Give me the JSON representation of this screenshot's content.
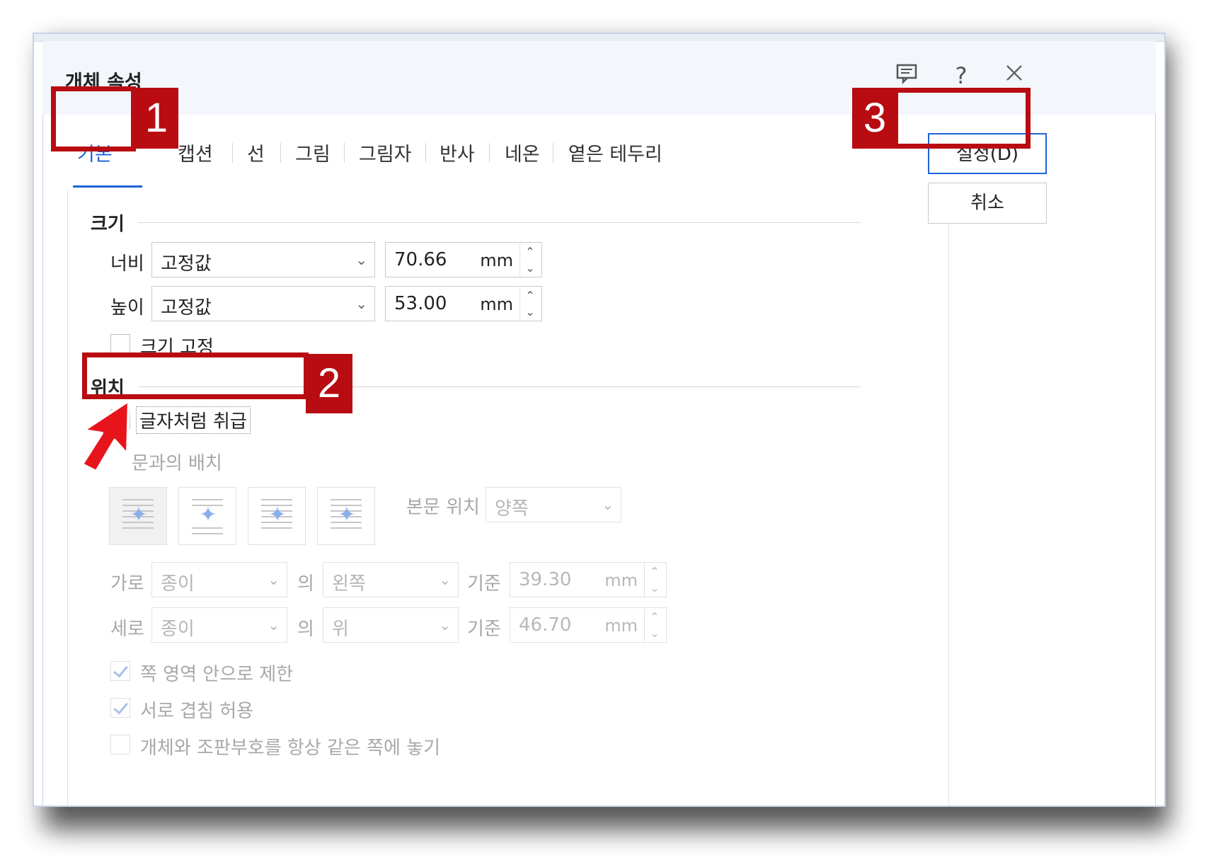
{
  "dialog": {
    "title": "개체 속성"
  },
  "titlebar_icons": [
    "comment-icon",
    "help-icon",
    "close-icon"
  ],
  "tabs": [
    "기본",
    "여백/캡션",
    "선",
    "그림",
    "그림자",
    "반사",
    "네온",
    "옅은 테두리"
  ],
  "tab_visible": {
    "caption": "캡션"
  },
  "size": {
    "section": "크기",
    "width_label": "너비",
    "width_mode": "고정값",
    "width_value": "70.66",
    "height_label": "높이",
    "height_mode": "고정값",
    "height_value": "53.00",
    "unit": "mm",
    "lock_label": "크기 고정"
  },
  "position": {
    "section": "위치",
    "treat_as_char_label": "글자처럼 취급",
    "text_wrap_label": "본문과의 배치",
    "text_wrap_visible": "문과의 배치",
    "body_position_label": "본문 위치",
    "body_position_value": "양쪽",
    "horiz_label": "가로",
    "horiz_ref": "종이",
    "of_label": "의",
    "horiz_align": "왼쪽",
    "base_label": "기준",
    "horiz_value": "39.30",
    "vert_label": "세로",
    "vert_ref": "종이",
    "vert_align": "위",
    "vert_value": "46.70",
    "limit_label": "쪽 영역 안으로 제한",
    "overlap_label": "서로 겹침 허용",
    "keep_label": "개체와 조판부호를 항상 같은 쪽에 놓기"
  },
  "buttons": {
    "ok": "설정(D)",
    "cancel": "취소"
  },
  "annotations": [
    "1",
    "2",
    "3"
  ],
  "colors": {
    "accent": "#1e63d6",
    "annotation": "#b80c12"
  }
}
